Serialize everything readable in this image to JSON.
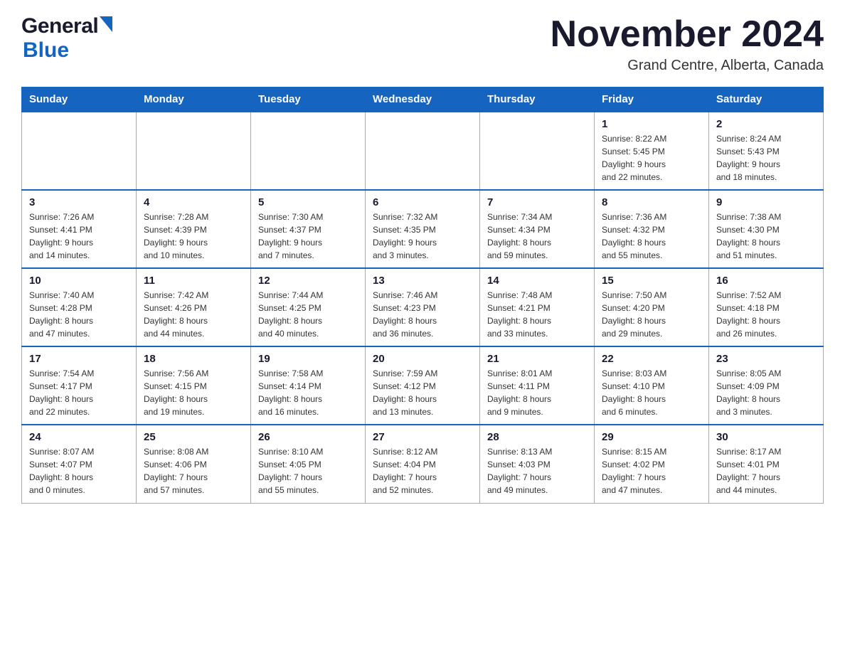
{
  "header": {
    "logo_general": "General",
    "logo_blue": "Blue",
    "month_title": "November 2024",
    "location": "Grand Centre, Alberta, Canada"
  },
  "weekdays": [
    "Sunday",
    "Monday",
    "Tuesday",
    "Wednesday",
    "Thursday",
    "Friday",
    "Saturday"
  ],
  "weeks": [
    [
      {
        "day": "",
        "info": ""
      },
      {
        "day": "",
        "info": ""
      },
      {
        "day": "",
        "info": ""
      },
      {
        "day": "",
        "info": ""
      },
      {
        "day": "",
        "info": ""
      },
      {
        "day": "1",
        "info": "Sunrise: 8:22 AM\nSunset: 5:45 PM\nDaylight: 9 hours\nand 22 minutes."
      },
      {
        "day": "2",
        "info": "Sunrise: 8:24 AM\nSunset: 5:43 PM\nDaylight: 9 hours\nand 18 minutes."
      }
    ],
    [
      {
        "day": "3",
        "info": "Sunrise: 7:26 AM\nSunset: 4:41 PM\nDaylight: 9 hours\nand 14 minutes."
      },
      {
        "day": "4",
        "info": "Sunrise: 7:28 AM\nSunset: 4:39 PM\nDaylight: 9 hours\nand 10 minutes."
      },
      {
        "day": "5",
        "info": "Sunrise: 7:30 AM\nSunset: 4:37 PM\nDaylight: 9 hours\nand 7 minutes."
      },
      {
        "day": "6",
        "info": "Sunrise: 7:32 AM\nSunset: 4:35 PM\nDaylight: 9 hours\nand 3 minutes."
      },
      {
        "day": "7",
        "info": "Sunrise: 7:34 AM\nSunset: 4:34 PM\nDaylight: 8 hours\nand 59 minutes."
      },
      {
        "day": "8",
        "info": "Sunrise: 7:36 AM\nSunset: 4:32 PM\nDaylight: 8 hours\nand 55 minutes."
      },
      {
        "day": "9",
        "info": "Sunrise: 7:38 AM\nSunset: 4:30 PM\nDaylight: 8 hours\nand 51 minutes."
      }
    ],
    [
      {
        "day": "10",
        "info": "Sunrise: 7:40 AM\nSunset: 4:28 PM\nDaylight: 8 hours\nand 47 minutes."
      },
      {
        "day": "11",
        "info": "Sunrise: 7:42 AM\nSunset: 4:26 PM\nDaylight: 8 hours\nand 44 minutes."
      },
      {
        "day": "12",
        "info": "Sunrise: 7:44 AM\nSunset: 4:25 PM\nDaylight: 8 hours\nand 40 minutes."
      },
      {
        "day": "13",
        "info": "Sunrise: 7:46 AM\nSunset: 4:23 PM\nDaylight: 8 hours\nand 36 minutes."
      },
      {
        "day": "14",
        "info": "Sunrise: 7:48 AM\nSunset: 4:21 PM\nDaylight: 8 hours\nand 33 minutes."
      },
      {
        "day": "15",
        "info": "Sunrise: 7:50 AM\nSunset: 4:20 PM\nDaylight: 8 hours\nand 29 minutes."
      },
      {
        "day": "16",
        "info": "Sunrise: 7:52 AM\nSunset: 4:18 PM\nDaylight: 8 hours\nand 26 minutes."
      }
    ],
    [
      {
        "day": "17",
        "info": "Sunrise: 7:54 AM\nSunset: 4:17 PM\nDaylight: 8 hours\nand 22 minutes."
      },
      {
        "day": "18",
        "info": "Sunrise: 7:56 AM\nSunset: 4:15 PM\nDaylight: 8 hours\nand 19 minutes."
      },
      {
        "day": "19",
        "info": "Sunrise: 7:58 AM\nSunset: 4:14 PM\nDaylight: 8 hours\nand 16 minutes."
      },
      {
        "day": "20",
        "info": "Sunrise: 7:59 AM\nSunset: 4:12 PM\nDaylight: 8 hours\nand 13 minutes."
      },
      {
        "day": "21",
        "info": "Sunrise: 8:01 AM\nSunset: 4:11 PM\nDaylight: 8 hours\nand 9 minutes."
      },
      {
        "day": "22",
        "info": "Sunrise: 8:03 AM\nSunset: 4:10 PM\nDaylight: 8 hours\nand 6 minutes."
      },
      {
        "day": "23",
        "info": "Sunrise: 8:05 AM\nSunset: 4:09 PM\nDaylight: 8 hours\nand 3 minutes."
      }
    ],
    [
      {
        "day": "24",
        "info": "Sunrise: 8:07 AM\nSunset: 4:07 PM\nDaylight: 8 hours\nand 0 minutes."
      },
      {
        "day": "25",
        "info": "Sunrise: 8:08 AM\nSunset: 4:06 PM\nDaylight: 7 hours\nand 57 minutes."
      },
      {
        "day": "26",
        "info": "Sunrise: 8:10 AM\nSunset: 4:05 PM\nDaylight: 7 hours\nand 55 minutes."
      },
      {
        "day": "27",
        "info": "Sunrise: 8:12 AM\nSunset: 4:04 PM\nDaylight: 7 hours\nand 52 minutes."
      },
      {
        "day": "28",
        "info": "Sunrise: 8:13 AM\nSunset: 4:03 PM\nDaylight: 7 hours\nand 49 minutes."
      },
      {
        "day": "29",
        "info": "Sunrise: 8:15 AM\nSunset: 4:02 PM\nDaylight: 7 hours\nand 47 minutes."
      },
      {
        "day": "30",
        "info": "Sunrise: 8:17 AM\nSunset: 4:01 PM\nDaylight: 7 hours\nand 44 minutes."
      }
    ]
  ]
}
